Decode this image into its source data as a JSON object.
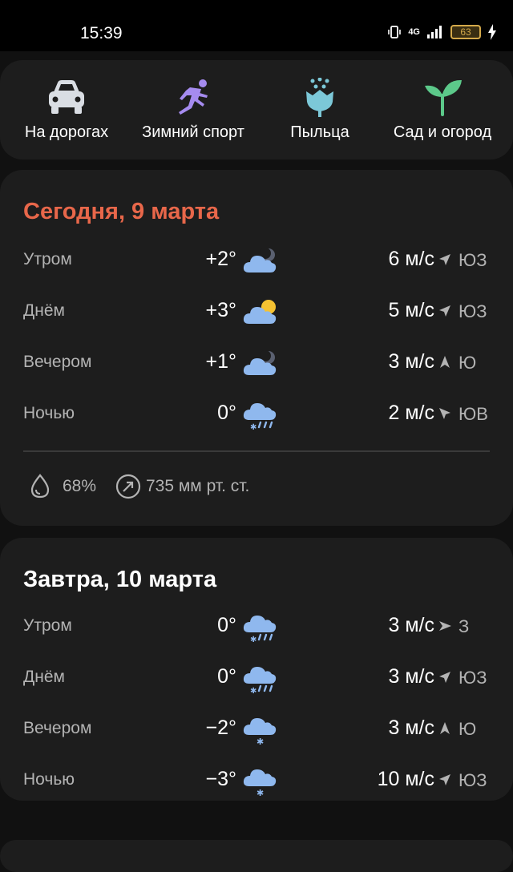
{
  "status_bar": {
    "time": "15:39",
    "network": "4G",
    "battery": "63"
  },
  "categories": [
    {
      "label": "На дорогах",
      "icon": "car-icon"
    },
    {
      "label": "Зимний спорт",
      "icon": "runner-icon"
    },
    {
      "label": "Пыльца",
      "icon": "flower-icon"
    },
    {
      "label": "Сад и огород",
      "icon": "sprout-icon"
    }
  ],
  "today": {
    "title": "Сегодня, 9 марта",
    "title_color": "#e8674a",
    "rows": [
      {
        "period": "Утром",
        "temp": "+2°",
        "icon": "cloudy-night-icon",
        "wind": "6 м/с",
        "dir": "ЮЗ"
      },
      {
        "period": "Днём",
        "temp": "+3°",
        "icon": "partly-sunny-icon",
        "wind": "5 м/с",
        "dir": "ЮЗ"
      },
      {
        "period": "Вечером",
        "temp": "+1°",
        "icon": "cloudy-night-icon",
        "wind": "3 м/с",
        "dir": "Ю"
      },
      {
        "period": "Ночью",
        "temp": "0°",
        "icon": "rain-snow-icon",
        "wind": "2 м/с",
        "dir": "ЮВ"
      }
    ],
    "humidity": "68%",
    "pressure": "735 мм рт. ст."
  },
  "tomorrow": {
    "title": "Завтра, 10 марта",
    "rows": [
      {
        "period": "Утром",
        "temp": "0°",
        "icon": "rain-snow-icon",
        "wind": "3 м/с",
        "dir": "З"
      },
      {
        "period": "Днём",
        "temp": "0°",
        "icon": "rain-snow-icon",
        "wind": "3 м/с",
        "dir": "ЮЗ"
      },
      {
        "period": "Вечером",
        "temp": "−2°",
        "icon": "snow-icon",
        "wind": "3 м/с",
        "dir": "Ю"
      },
      {
        "period": "Ночью",
        "temp": "−3°",
        "icon": "snow-icon",
        "wind": "10 м/с",
        "dir": "ЮЗ"
      }
    ]
  },
  "colors": {
    "cloud": "#8fb8ee",
    "sun": "#f5c232",
    "runner": "#a58bef",
    "flower": "#7cc8d8",
    "sprout": "#5cc98a"
  }
}
